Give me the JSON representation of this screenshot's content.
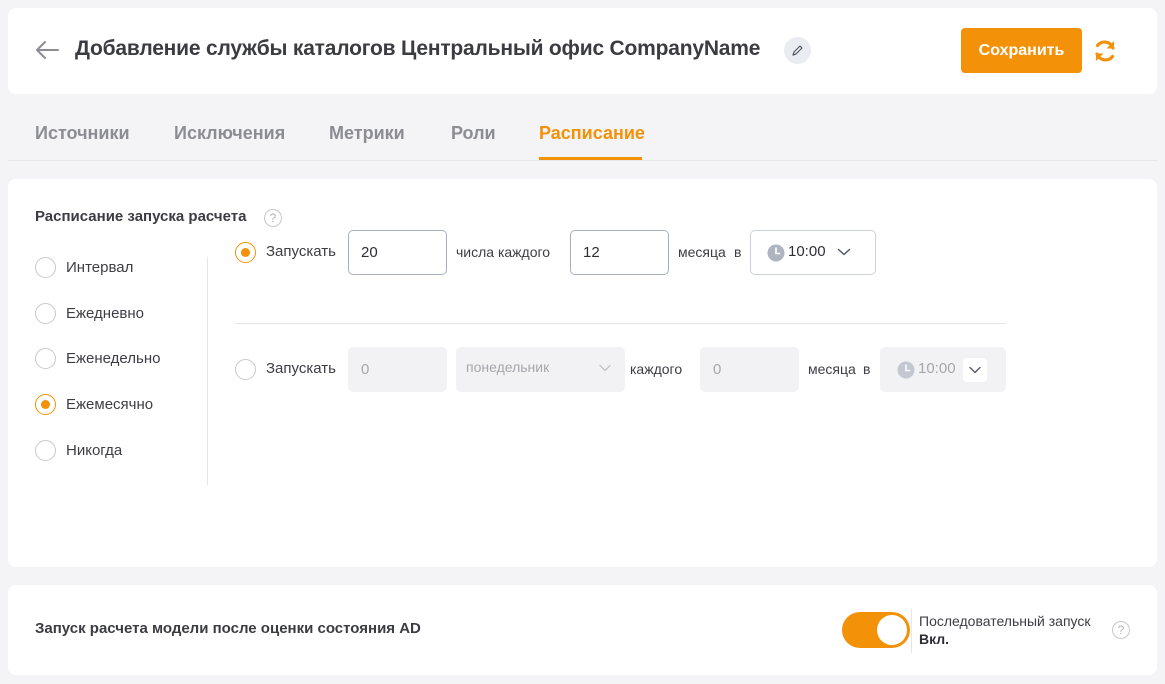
{
  "header": {
    "title": "Добавление службы каталогов Центральный офис CompanyName",
    "save_label": "Сохранить"
  },
  "tabs": [
    {
      "label": "Источники",
      "active": false
    },
    {
      "label": "Исключения",
      "active": false
    },
    {
      "label": "Метрики",
      "active": false
    },
    {
      "label": "Роли",
      "active": false
    },
    {
      "label": "Расписание",
      "active": true
    }
  ],
  "schedule": {
    "title": "Расписание запуска расчета",
    "help": "?",
    "options": [
      {
        "label": "Интервал",
        "checked": false
      },
      {
        "label": "Ежедневно",
        "checked": false
      },
      {
        "label": "Еженедельно",
        "checked": false
      },
      {
        "label": "Ежемесячно",
        "checked": true
      },
      {
        "label": "Никогда",
        "checked": false
      }
    ],
    "row1": {
      "checked": true,
      "run_label": "Запускать",
      "day_value": "20",
      "day_text": "числа каждого",
      "month_value": "12",
      "month_text": "месяца",
      "at_text": "в",
      "time": "10:00"
    },
    "row2": {
      "checked": false,
      "run_label": "Запускать",
      "week_placeholder": "0",
      "weekday": "понедельник",
      "every_text": "каждого",
      "month_placeholder": "0",
      "month_text": "месяца",
      "at_text": "в",
      "time": "10:00"
    }
  },
  "bottom": {
    "title": "Запуск расчета модели после оценки состояния AD",
    "toggle_on": true,
    "seq_label": "Последовательный запуск",
    "seq_value": "Вкл.",
    "help": "?"
  },
  "colors": {
    "accent": "#f39108",
    "background": "#f4f4f7",
    "card": "#ffffff",
    "text": "#3b3b42",
    "muted": "#8c8c93"
  },
  "icons": [
    "back-arrow-icon",
    "pencil-icon",
    "refresh-icon",
    "help-icon",
    "clock-icon",
    "chevron-down-icon"
  ]
}
